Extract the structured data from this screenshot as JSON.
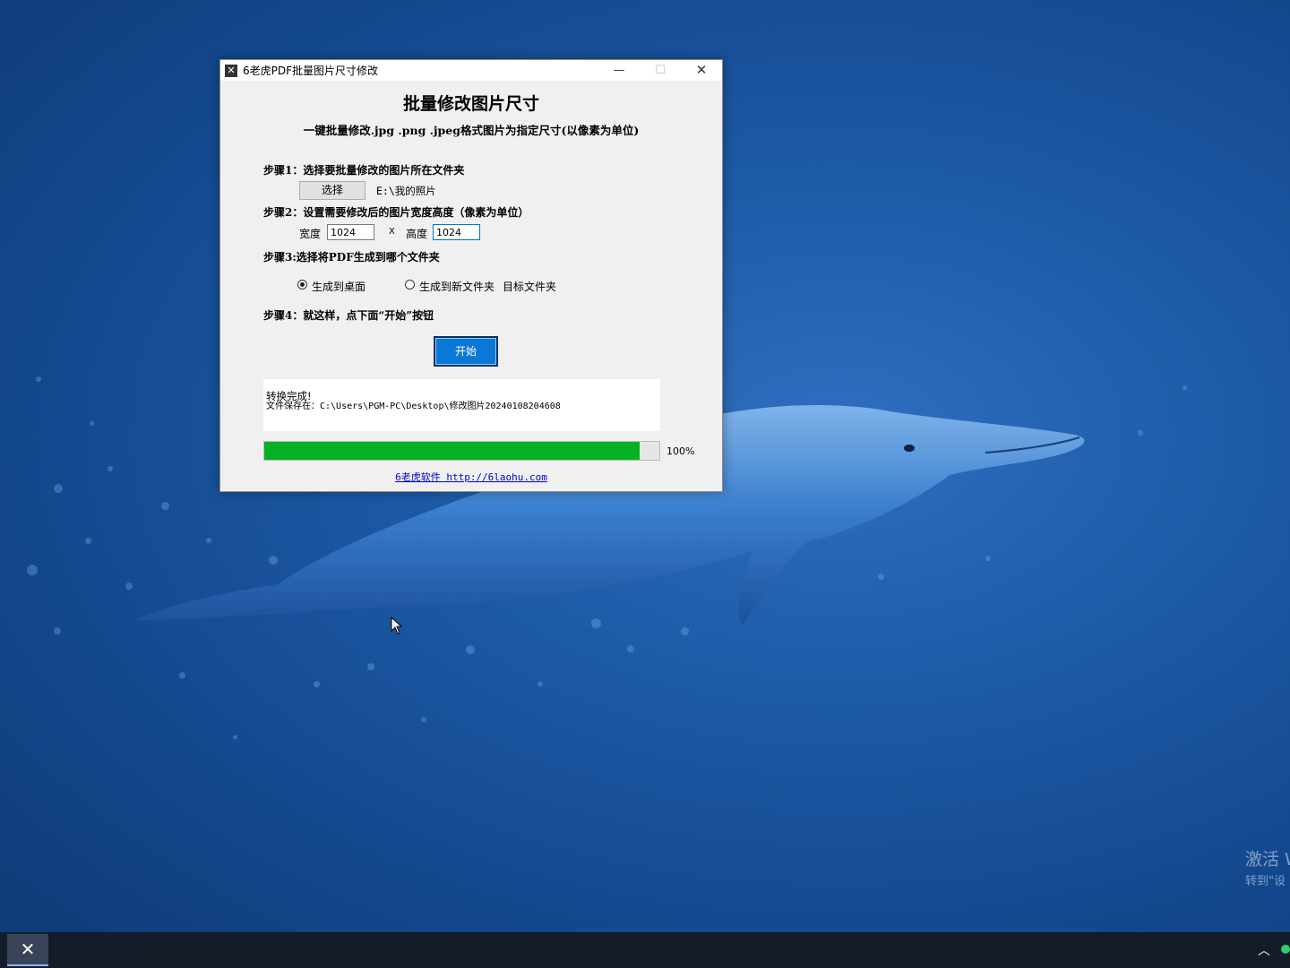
{
  "window": {
    "title": "6老虎PDF批量图片尺寸修改",
    "minimize": "—",
    "maximize": "☐",
    "close": "✕"
  },
  "main": {
    "heading": "批量修改图片尺寸",
    "subheading": "一键批量修改.jpg .png .jpeg格式图片为指定尺寸(以像素为单位)",
    "step1": "步骤1：选择要批量修改的图片所在文件夹",
    "select_button": "选择",
    "selected_path": "E:\\我的照片",
    "step2": "步骤2：设置需要修改后的图片宽度高度（像素为单位）",
    "width_label": "宽度",
    "width_value": "1024",
    "x_label": "X",
    "height_label": "高度",
    "height_value": "1024",
    "step3": "步骤3:选择将PDF生成到哪个文件夹",
    "radio_desktop": "生成到桌面",
    "radio_new_folder": "生成到新文件夹",
    "target_folder": "目标文件夹",
    "step4": "步骤4：就这样，点下面“开始”按钮",
    "start_button": "开始",
    "output_line1": "转换完成!",
    "output_line2": "文件保存在：C:\\Users\\PGM-PC\\Desktop\\修改图片20240108204608",
    "progress_percent": 100,
    "progress_label": "100%",
    "footer_link": "6老虎软件 http://6laohu.com"
  },
  "desktop": {
    "watermark_line1": "激活 W",
    "watermark_line2": "转到\"设"
  },
  "taskbar": {
    "tray_arrow": "︿"
  },
  "colors": {
    "progress_fill": "#06b025",
    "start_button": "#0a78d7",
    "desktop_bg": "#1d5aa6"
  }
}
